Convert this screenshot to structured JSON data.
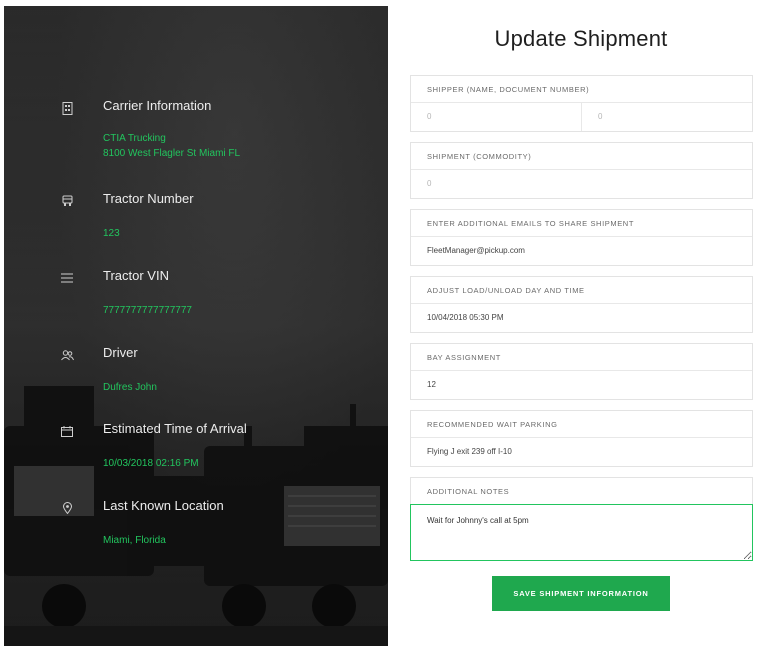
{
  "form": {
    "title": "Update Shipment",
    "save_label": "SAVE SHIPMENT INFORMATION",
    "fields": {
      "shipper": {
        "label": "SHIPPER (NAME, DOCUMENT NUMBER)",
        "value_left": "0",
        "value_right": "0"
      },
      "commodity": {
        "label": "SHIPMENT (COMMODITY)",
        "value": "0"
      },
      "emails": {
        "label": "ENTER ADDITIONAL EMAILS TO SHARE SHIPMENT",
        "value": "FleetManager@pickup.com"
      },
      "load_time": {
        "label": "ADJUST LOAD/UNLOAD DAY AND TIME",
        "value": "10/04/2018 05:30 PM"
      },
      "bay": {
        "label": "BAY ASSIGNMENT",
        "value": "12"
      },
      "parking": {
        "label": "RECOMMENDED WAIT PARKING",
        "value": "Flying J exit 239 off I-10"
      },
      "notes": {
        "label": "ADDITIONAL NOTES",
        "value": "Wait for Johnny's call at 5pm"
      }
    }
  },
  "info": {
    "carrier": {
      "title": "Carrier Information",
      "name": "CTIA Trucking",
      "address": "8100 West Flagler St Miami FL",
      "icon": "building-icon"
    },
    "tractor_number": {
      "title": "Tractor Number",
      "value": "123",
      "icon": "truck-icon"
    },
    "tractor_vin": {
      "title": "Tractor VIN",
      "value": "7777777777777777",
      "icon": "list-icon"
    },
    "driver": {
      "title": "Driver",
      "value": "Dufres John",
      "icon": "users-icon"
    },
    "eta": {
      "title": "Estimated Time of Arrival",
      "value": "10/03/2018 02:16 PM",
      "icon": "calendar-icon"
    },
    "location": {
      "title": "Last Known Location",
      "value": "Miami, Florida",
      "icon": "map-pin-icon"
    }
  },
  "colors": {
    "accent": "#22c55e",
    "button": "#1fa84e",
    "panel_dark": "#1e1e1e"
  }
}
